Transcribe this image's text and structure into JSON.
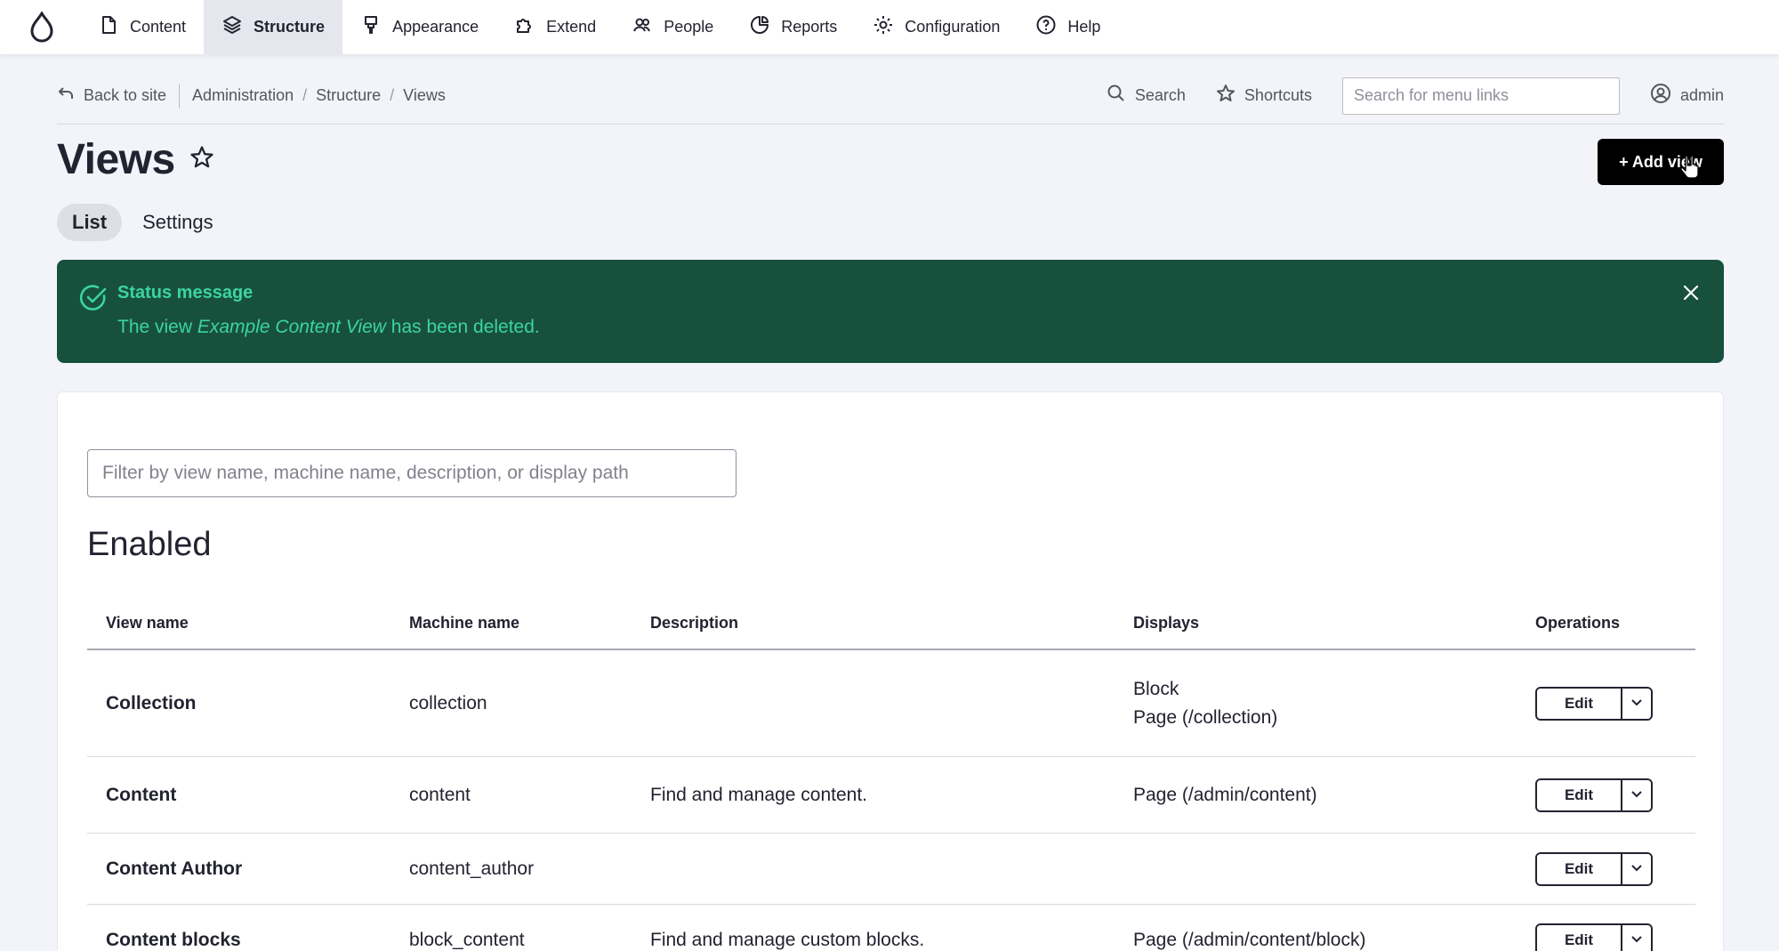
{
  "toolbar": {
    "items": [
      {
        "label": "Content",
        "icon": "file-icon"
      },
      {
        "label": "Structure",
        "icon": "layers-icon",
        "active": true
      },
      {
        "label": "Appearance",
        "icon": "brush-icon"
      },
      {
        "label": "Extend",
        "icon": "puzzle-icon"
      },
      {
        "label": "People",
        "icon": "people-icon"
      },
      {
        "label": "Reports",
        "icon": "pie-chart-icon"
      },
      {
        "label": "Configuration",
        "icon": "gear-icon"
      },
      {
        "label": "Help",
        "icon": "help-icon"
      }
    ]
  },
  "secondary": {
    "back_label": "Back to site",
    "breadcrumbs": [
      "Administration",
      "Structure",
      "Views"
    ],
    "search_label": "Search",
    "shortcuts_label": "Shortcuts",
    "menu_search_placeholder": "Search for menu links",
    "user_label": "admin"
  },
  "page": {
    "title": "Views",
    "add_button": "+ Add view",
    "tabs": [
      {
        "label": "List",
        "active": true
      },
      {
        "label": "Settings",
        "active": false
      }
    ]
  },
  "status": {
    "title": "Status message",
    "msg_prefix": "The view ",
    "msg_name": "Example Content View",
    "msg_suffix": " has been deleted."
  },
  "listing": {
    "filter_placeholder": "Filter by view name, machine name, description, or display path",
    "section_title": "Enabled",
    "columns": [
      "View name",
      "Machine name",
      "Description",
      "Displays",
      "Operations"
    ],
    "edit_label": "Edit",
    "rows": [
      {
        "name": "Collection",
        "machine": "collection",
        "description": "",
        "displays": [
          "Block",
          "Page (/collection)"
        ]
      },
      {
        "name": "Content",
        "machine": "content",
        "description": "Find and manage content.",
        "displays": [
          "Page (/admin/content)"
        ]
      },
      {
        "name": "Content Author",
        "machine": "content_author",
        "description": "",
        "displays": []
      },
      {
        "name": "Content blocks",
        "machine": "block_content",
        "description": "Find and manage custom blocks.",
        "displays": [
          "Page (/admin/content/block)"
        ]
      }
    ]
  },
  "colors": {
    "status_bg": "#18503e",
    "status_text": "#3bd59e",
    "primary_button": "#000000"
  }
}
